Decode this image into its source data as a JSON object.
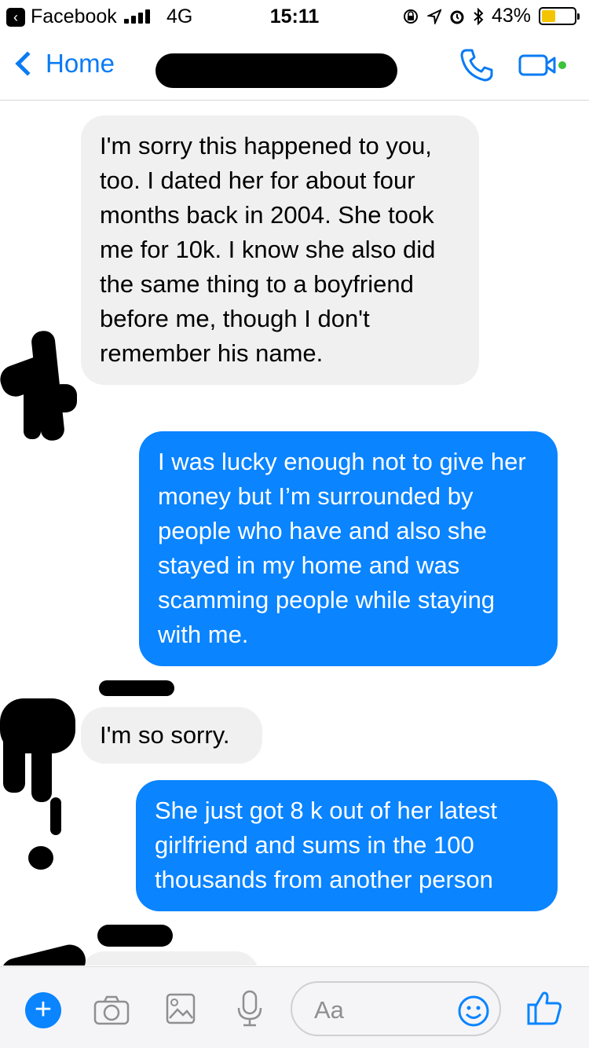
{
  "status_bar": {
    "back_app": "Facebook",
    "back_app_icon": "chevron-left",
    "network": "4G",
    "time": "15:11",
    "battery_percent": "43%",
    "battery_level": 0.43,
    "icons": [
      "lock-rotation-icon",
      "location-arrow-icon",
      "alarm-icon",
      "bluetooth-icon"
    ]
  },
  "nav": {
    "back_label": "Home",
    "actions": [
      "phone-icon",
      "video-camera-icon"
    ],
    "accent_color": "#0a7bf3",
    "active_dot_color": "#3cc23c"
  },
  "messages": [
    {
      "direction": "incoming",
      "text": "I'm sorry this happened to you, too. I dated her for about four months back in 2004. She took me for 10k. I know she also did the same thing to a boyfriend before me, though I don't remember his name."
    },
    {
      "direction": "outgoing",
      "text": "I was lucky enough not to give her money but I’m surrounded by people who have and also she stayed in my home and was scamming people while staying with me."
    },
    {
      "direction": "incoming",
      "text": "I'm so sorry."
    },
    {
      "direction": "outgoing",
      "text": "She just got 8 k out of her latest girlfriend and sums in the 100 thousands from another person"
    }
  ],
  "colors": {
    "outgoing_bubble": "#0a84ff",
    "incoming_bubble": "#f0f0f0"
  },
  "composer": {
    "placeholder": "Aa",
    "buttons": [
      "plus-icon",
      "camera-icon",
      "image-icon",
      "microphone-icon",
      "emoji-icon",
      "thumbs-up-icon"
    ]
  }
}
